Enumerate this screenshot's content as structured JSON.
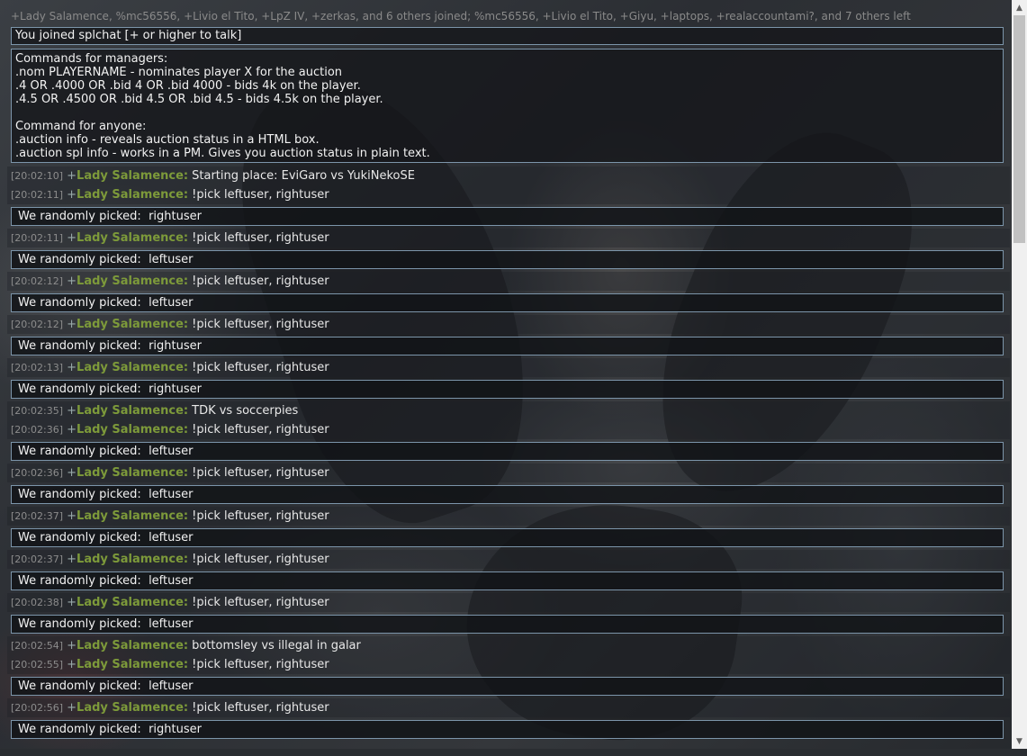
{
  "notice": "+Lady Salamence, %mc56556, +Livio el Tito, +LpZ IV, +zerkas, and 6 others joined; %mc56556, +Livio el Tito, +Giyu, +laptops, +realaccountami?, and 7 others left",
  "joined_text": "You joined splchat [+ or higher to talk]",
  "commands": [
    "Commands for managers:",
    ".nom PLAYERNAME - nominates player X for the auction",
    ".4 OR .4000 OR .bid 4 OR .bid 4000 - bids 4k on the player.",
    ".4.5 OR .4500 OR .bid 4.5 OR .bid 4.5 - bids 4.5k on the player.",
    "",
    "Command for anyone:",
    ".auction info - reveals auction status in a HTML box.",
    ".auction spl info - works in a PM. Gives you auction status in plain text."
  ],
  "pick_prefix": "We randomly picked:  ",
  "messages": [
    {
      "ts": "[20:02:10]",
      "rank": "+",
      "user": "Lady Salamence:",
      "text": "Starting place: EviGaro vs YukiNekoSE"
    },
    {
      "ts": "[20:02:11]",
      "rank": "+",
      "user": "Lady Salamence:",
      "text": "!pick leftuser, rightuser",
      "pick": "rightuser"
    },
    {
      "ts": "[20:02:11]",
      "rank": "+",
      "user": "Lady Salamence:",
      "text": "!pick leftuser, rightuser",
      "pick": "leftuser"
    },
    {
      "ts": "[20:02:12]",
      "rank": "+",
      "user": "Lady Salamence:",
      "text": "!pick leftuser, rightuser",
      "pick": "leftuser"
    },
    {
      "ts": "[20:02:12]",
      "rank": "+",
      "user": "Lady Salamence:",
      "text": "!pick leftuser, rightuser",
      "pick": "rightuser"
    },
    {
      "ts": "[20:02:13]",
      "rank": "+",
      "user": "Lady Salamence:",
      "text": "!pick leftuser, rightuser",
      "pick": "rightuser"
    },
    {
      "ts": "[20:02:35]",
      "rank": "+",
      "user": "Lady Salamence:",
      "text": "TDK vs soccerpies"
    },
    {
      "ts": "[20:02:36]",
      "rank": "+",
      "user": "Lady Salamence:",
      "text": "!pick leftuser, rightuser",
      "pick": "leftuser"
    },
    {
      "ts": "[20:02:36]",
      "rank": "+",
      "user": "Lady Salamence:",
      "text": "!pick leftuser, rightuser",
      "pick": "leftuser"
    },
    {
      "ts": "[20:02:37]",
      "rank": "+",
      "user": "Lady Salamence:",
      "text": "!pick leftuser, rightuser",
      "pick": "leftuser"
    },
    {
      "ts": "[20:02:37]",
      "rank": "+",
      "user": "Lady Salamence:",
      "text": "!pick leftuser, rightuser",
      "pick": "leftuser"
    },
    {
      "ts": "[20:02:38]",
      "rank": "+",
      "user": "Lady Salamence:",
      "text": "!pick leftuser, rightuser",
      "pick": "leftuser"
    },
    {
      "ts": "[20:02:54]",
      "rank": "+",
      "user": "Lady Salamence:",
      "text": "bottomsley vs illegal in galar"
    },
    {
      "ts": "[20:02:55]",
      "rank": "+",
      "user": "Lady Salamence:",
      "text": "!pick leftuser, rightuser",
      "pick": "leftuser"
    },
    {
      "ts": "[20:02:56]",
      "rank": "+",
      "user": "Lady Salamence:",
      "text": "!pick leftuser, rightuser",
      "pick": "rightuser"
    }
  ],
  "scrollbar": {
    "up_icon": "triangle-up-icon",
    "down_icon": "triangle-down-icon"
  },
  "colors": {
    "username": "#7d9a3a",
    "border": "#7c95aa",
    "timestamp": "#8c8c8c"
  }
}
